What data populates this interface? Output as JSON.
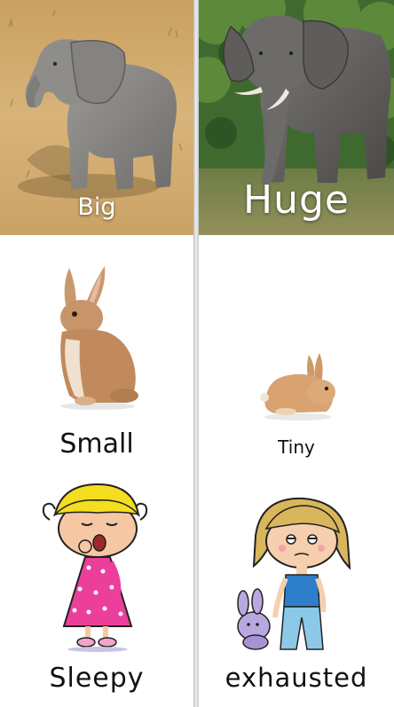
{
  "cards": {
    "big": {
      "label": "Big"
    },
    "huge": {
      "label": "Huge"
    },
    "small": {
      "label": "Small"
    },
    "tiny": {
      "label": "Tiny"
    },
    "sleepy": {
      "label": "Sleepy"
    },
    "exhausted": {
      "label": "exhausted"
    }
  }
}
